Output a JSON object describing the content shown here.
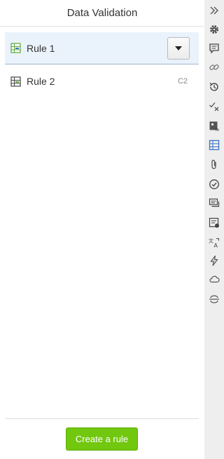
{
  "panel": {
    "title": "Data Validation",
    "rules": [
      {
        "label": "Rule 1",
        "range": "",
        "selected": true
      },
      {
        "label": "Rule 2",
        "range": "C2",
        "selected": false
      }
    ],
    "create_button": "Create a rule"
  },
  "colors": {
    "accent_green": "#71c80f",
    "selected_row_bg": "#eaf2fb",
    "sidebar_bg": "#eeeeee",
    "active_icon": "#3b73c8"
  },
  "sidebar_icons": [
    "collapse-icon",
    "settings-icon",
    "comments-icon",
    "link-icon",
    "history-icon",
    "check-remove-icon",
    "formula-icon",
    "data-validation-icon",
    "attachment-icon",
    "tasks-icon",
    "conversations-icon",
    "note-icon",
    "translate-icon",
    "lightning-icon",
    "cloud-icon",
    "connection-icon"
  ],
  "sidebar_active": "data-validation-icon"
}
